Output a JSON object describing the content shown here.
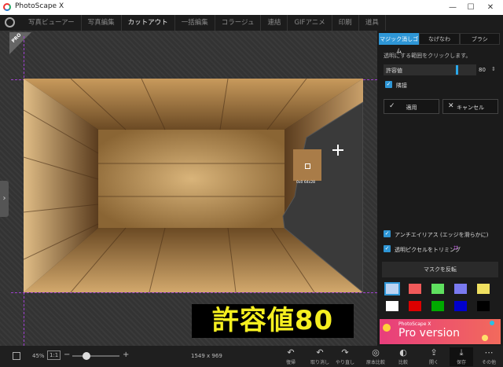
{
  "window": {
    "title": "PhotoScape X",
    "controls": [
      "—",
      "☐",
      "✕"
    ]
  },
  "tabs": [
    {
      "label": "写真ビューアー",
      "active": false
    },
    {
      "label": "写真編集",
      "active": false
    },
    {
      "label": "カットアウト",
      "active": true
    },
    {
      "label": "一括編集",
      "active": false
    },
    {
      "label": "コラージュ",
      "active": false
    },
    {
      "label": "連結",
      "active": false
    },
    {
      "label": "GIFアニメ",
      "active": false
    },
    {
      "label": "印刷",
      "active": false
    },
    {
      "label": "道具",
      "active": false
    }
  ],
  "canvas": {
    "pro_badge": "PRO",
    "selection_size": "0x0 64x28",
    "caption": "許容値80"
  },
  "panel": {
    "tabs": [
      "マジック消しゴム",
      "なげなわ",
      "ブラシ"
    ],
    "active_tab": 0,
    "hint": "透明にする範囲をクリックします。",
    "tolerance_label": "許容値",
    "tolerance_value": "80",
    "tolerance_fraction": 0.8,
    "contiguous_label": "隣接",
    "apply_label": "適用",
    "cancel_label": "キャンセル",
    "antialias_label": "アンチエイリアス (エッジを滑らかに)",
    "trim_label": "透明ピクセルをトリミング",
    "invert_mask_label": "マスクを反転",
    "swatches": [
      "#bcd3f2",
      "#f05a5a",
      "#5fe05f",
      "#7a7af0",
      "#f0e060",
      "#ffffff",
      "#dd0000",
      "#00aa00",
      "#0000cc",
      "#000000"
    ],
    "banner_brand": "PhotoScape X",
    "banner_text": "Pro version"
  },
  "statusbar": {
    "zoom": "45%",
    "ratio": "1:1",
    "dimensions": "1549 x 969",
    "minus": "−",
    "plus": "+",
    "zoom_fraction": 0.25,
    "tools": [
      {
        "label": "復帰",
        "icon": "↶"
      },
      {
        "label": "取り消し",
        "icon": "↶"
      },
      {
        "label": "やり直し",
        "icon": "↷"
      },
      {
        "label": "原本比較",
        "icon": "◎"
      },
      {
        "label": "比較",
        "icon": "◐"
      },
      {
        "label": "開く",
        "icon": "⇪"
      },
      {
        "label": "保存",
        "icon": "⤓"
      },
      {
        "label": "その他",
        "icon": "⋯"
      }
    ]
  }
}
